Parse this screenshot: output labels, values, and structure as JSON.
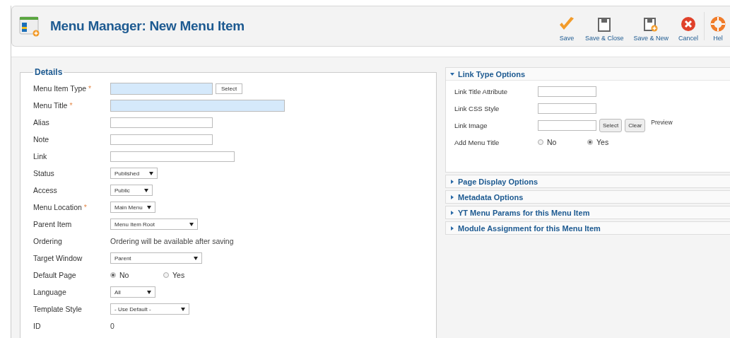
{
  "header": {
    "title": "Menu Manager: New Menu Item"
  },
  "toolbar": [
    {
      "kind": "save",
      "label": "Save"
    },
    {
      "kind": "save-close",
      "label": "Save & Close"
    },
    {
      "kind": "save-new",
      "label": "Save & New"
    },
    {
      "kind": "cancel",
      "label": "Cancel"
    },
    {
      "kind": "help",
      "label": "Hel"
    }
  ],
  "details": {
    "legend": "Details",
    "required_mark": "*",
    "rows": [
      {
        "kind": "input",
        "label": "Menu Item Type",
        "required": true,
        "button": "Select"
      },
      {
        "kind": "input",
        "label": "Menu Title",
        "required": true
      },
      {
        "kind": "input",
        "label": "Alias",
        "required": false
      },
      {
        "kind": "input",
        "label": "Note",
        "required": false
      },
      {
        "kind": "input",
        "label": "Link",
        "required": false
      },
      {
        "kind": "select",
        "label": "Status",
        "required": false,
        "value": "Published"
      },
      {
        "kind": "select",
        "label": "Access",
        "required": false,
        "value": "Public"
      },
      {
        "kind": "select",
        "label": "Menu Location",
        "required": true,
        "value": "Main Menu"
      },
      {
        "kind": "select",
        "label": "Parent Item",
        "required": false,
        "value": "Menu Item Root"
      },
      {
        "kind": "static",
        "label": "Ordering",
        "required": false,
        "value": "Ordering will be available after saving"
      },
      {
        "kind": "select",
        "label": "Target Window",
        "required": false,
        "value": "Parent"
      },
      {
        "kind": "radio",
        "label": "Default Page",
        "required": false,
        "options": [
          {
            "label": "No",
            "selected": true
          },
          {
            "label": "Yes",
            "selected": false
          }
        ]
      },
      {
        "kind": "select",
        "label": "Language",
        "required": false,
        "value": "All"
      },
      {
        "kind": "select",
        "label": "Template Style",
        "required": false,
        "value": "- Use Default -"
      },
      {
        "kind": "static",
        "label": "ID",
        "required": false,
        "value": "0"
      }
    ]
  },
  "panels": [
    {
      "title": "Link Type Options",
      "expanded": true,
      "rows": [
        {
          "kind": "input",
          "label": "Link Title Attribute"
        },
        {
          "kind": "input",
          "label": "Link CSS Style"
        },
        {
          "kind": "image",
          "label": "Link Image",
          "buttons": [
            "Select",
            "Clear"
          ],
          "preview": "Preview"
        },
        {
          "kind": "radio",
          "label": "Add Menu Title",
          "options": [
            {
              "label": "No",
              "selected": false
            },
            {
              "label": "Yes",
              "selected": true
            }
          ]
        }
      ]
    },
    {
      "title": "Page Display Options",
      "expanded": false
    },
    {
      "title": "Metadata Options",
      "expanded": false
    },
    {
      "title": "YT Menu Params for this Menu Item",
      "expanded": false
    },
    {
      "title": "Module Assignment for this Menu Item",
      "expanded": false
    }
  ]
}
